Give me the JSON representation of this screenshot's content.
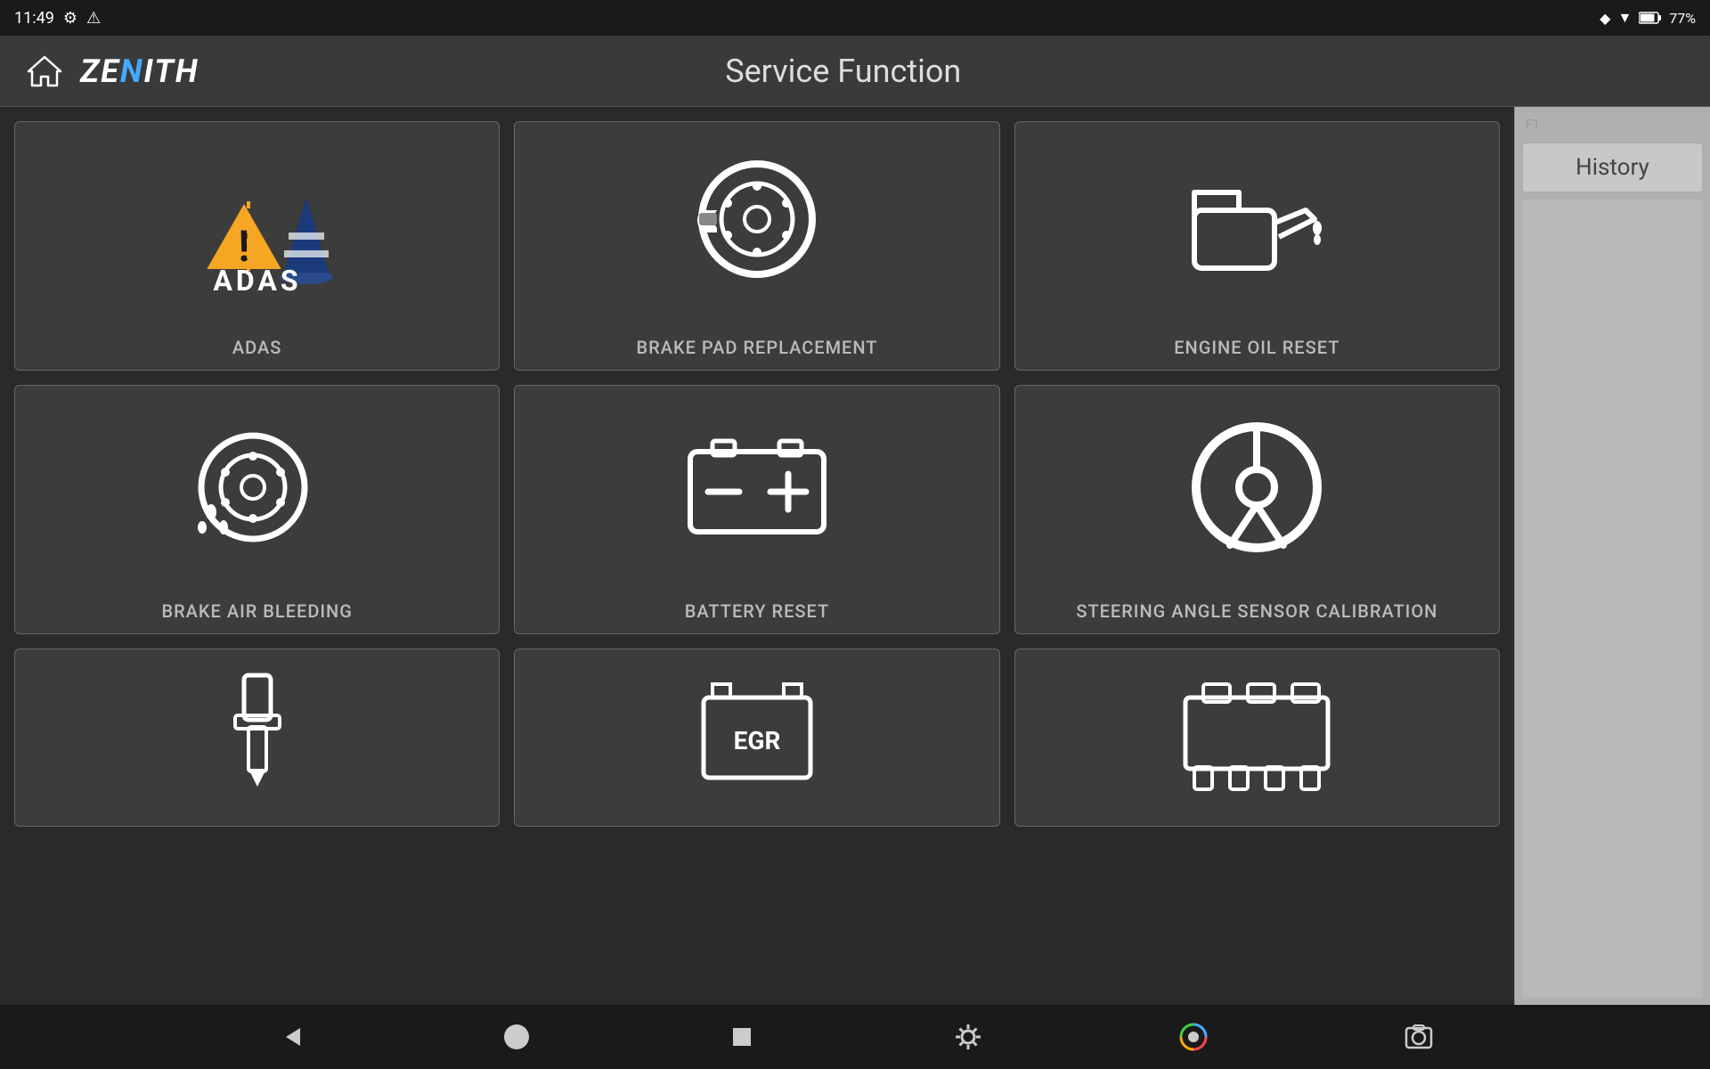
{
  "status_bar": {
    "time": "11:49",
    "battery": "77%"
  },
  "nav": {
    "title": "Service Function",
    "logo": "ZENITH"
  },
  "sidebar": {
    "f1_label": "F1",
    "history_label": "History"
  },
  "service_cards": [
    {
      "id": "adas",
      "label": "ADAS",
      "icon_type": "adas"
    },
    {
      "id": "brake-pad",
      "label": "BRAKE PAD REPLACEMENT",
      "icon_type": "brake-pad"
    },
    {
      "id": "engine-oil",
      "label": "ENGINE OIL RESET",
      "icon_type": "engine-oil"
    },
    {
      "id": "brake-air",
      "label": "BRAKE AIR BLEEDING",
      "icon_type": "brake-air"
    },
    {
      "id": "battery",
      "label": "BATTERY RESET",
      "icon_type": "battery"
    },
    {
      "id": "steering",
      "label": "STEERING ANGLE SENSOR CALIBRATION",
      "icon_type": "steering"
    },
    {
      "id": "injector",
      "label": "",
      "icon_type": "injector"
    },
    {
      "id": "egr",
      "label": "",
      "icon_type": "egr"
    },
    {
      "id": "throttle",
      "label": "",
      "icon_type": "throttle"
    }
  ],
  "bottom_bar": {
    "back_label": "◄",
    "home_label": "●",
    "square_label": "■",
    "settings_label": "⚙",
    "chrome_label": "chrome",
    "camera_label": "camera"
  }
}
